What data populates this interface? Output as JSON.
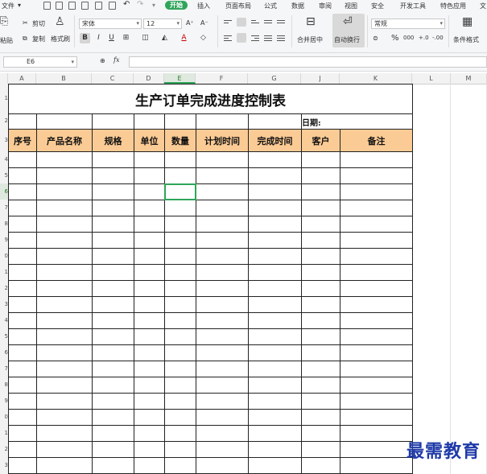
{
  "menu": {
    "file": "文件",
    "tabs": [
      "开始",
      "插入",
      "页面布局",
      "公式",
      "数据",
      "审阅",
      "视图",
      "安全",
      "开发工具",
      "特色应用",
      "文"
    ],
    "active": "开始"
  },
  "ribbon": {
    "paste": "粘贴",
    "cut": "剪切",
    "copy": "复制",
    "format_painter": "格式刷",
    "font_name": "宋体",
    "font_size": "12",
    "bold": "B",
    "italic": "I",
    "underline": "U",
    "grow": "A⁺",
    "shrink": "A⁻",
    "merge_center": "合并居中",
    "wrap_text": "自动换行",
    "number_format": "常规",
    "percent": "%",
    "thousands": "000",
    "inc_decimal": "+.0",
    "dec_decimal": "-.00",
    "conditional_format": "条件格式"
  },
  "formula_bar": {
    "cell_ref": "E6",
    "fx": "fx",
    "value": ""
  },
  "columns": [
    "A",
    "B",
    "C",
    "D",
    "E",
    "F",
    "G",
    "J",
    "K",
    "L",
    "M"
  ],
  "rows": [
    "1",
    "2",
    "3",
    "4",
    "5",
    "6",
    "7",
    "8",
    "9",
    "0",
    "1",
    "2",
    "3",
    "4",
    "5",
    "6",
    "7",
    "8",
    "9",
    "0",
    "1",
    "2",
    "3"
  ],
  "sheet": {
    "title": "生产订单完成进度控制表",
    "date_label": "日期:",
    "headers": [
      "序号",
      "产品名称",
      "规格",
      "单位",
      "数量",
      "计划时间",
      "完成时间",
      "客户",
      "备注"
    ]
  },
  "watermark": "最需教育",
  "colors": {
    "accent": "#2fa55a",
    "header_fill": "#fbcb95",
    "watermark": "#1e3aa8"
  }
}
